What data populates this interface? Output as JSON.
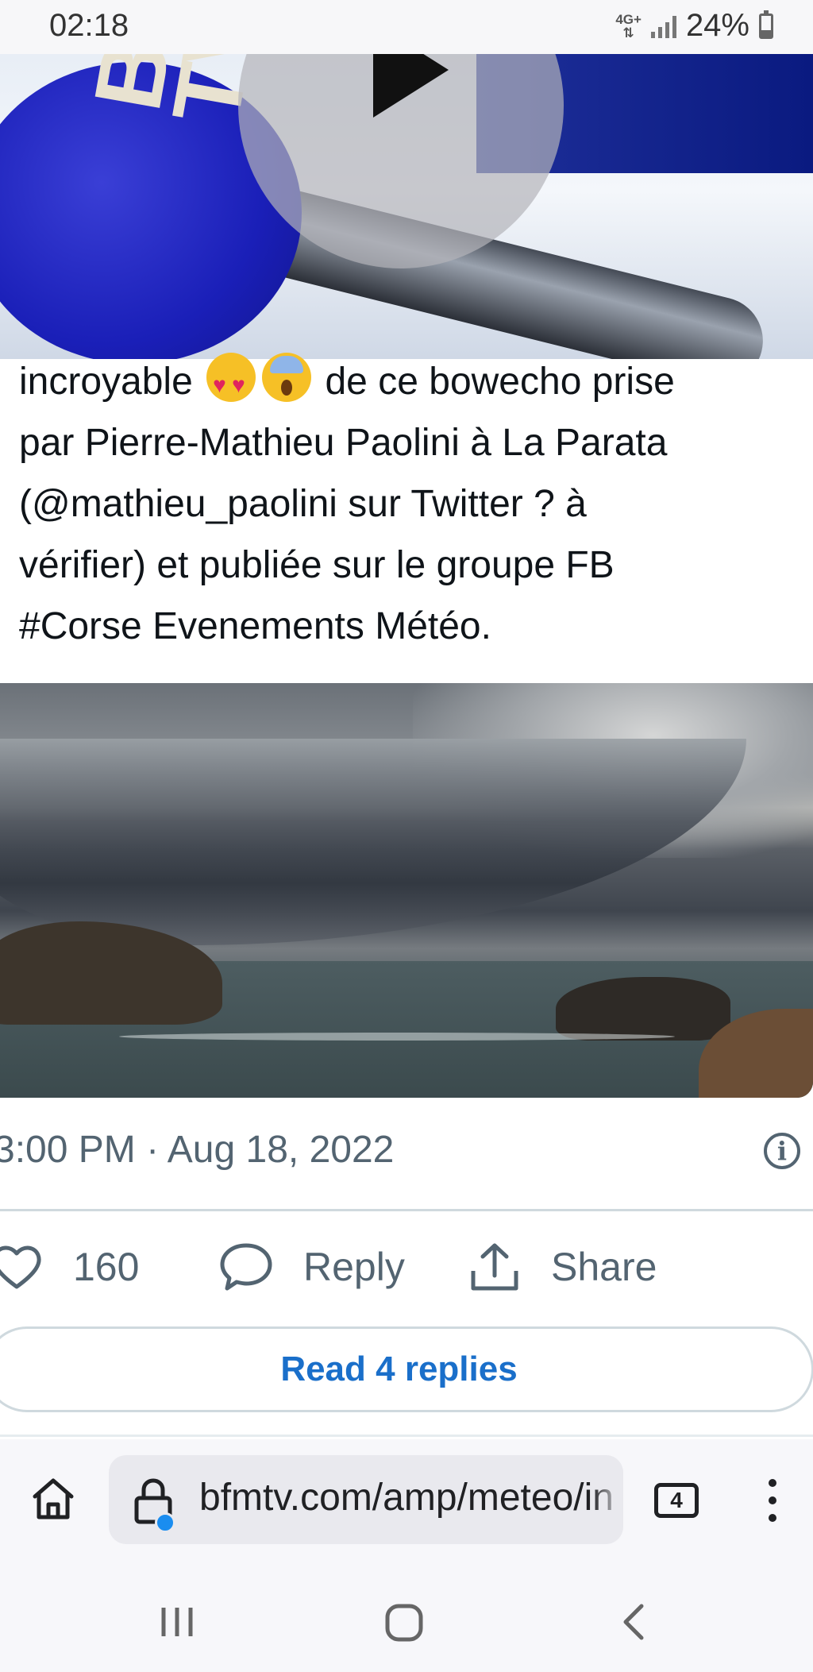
{
  "status_bar": {
    "time": "02:18",
    "network_type": "4G+",
    "battery_percent": "24%"
  },
  "video": {
    "logo_text_line1": "BFM",
    "logo_text_line2": "TV."
  },
  "tweet": {
    "text_line1_word": "incroyable",
    "text_line1_rest": "de ce bowecho prise",
    "text_line2": "par Pierre-Mathieu Paolini à La Parata",
    "text_line3": "(@mathieu_paolini sur Twitter ? à",
    "text_line4": "vérifier) et publiée sur le groupe FB",
    "text_line5": "#Corse Evenements Météo.",
    "timestamp": "3:00 PM · Aug 18, 2022"
  },
  "actions": {
    "like_count": "160",
    "reply_label": "Reply",
    "share_label": "Share"
  },
  "read_replies_label": "Read 4 replies",
  "browser": {
    "url": "bfmtv.com/amp/meteo/in",
    "tab_count": "4"
  },
  "colors": {
    "link_blue": "#1a6fca",
    "muted_gray": "#536471",
    "secure_dot": "#1a8df0"
  }
}
